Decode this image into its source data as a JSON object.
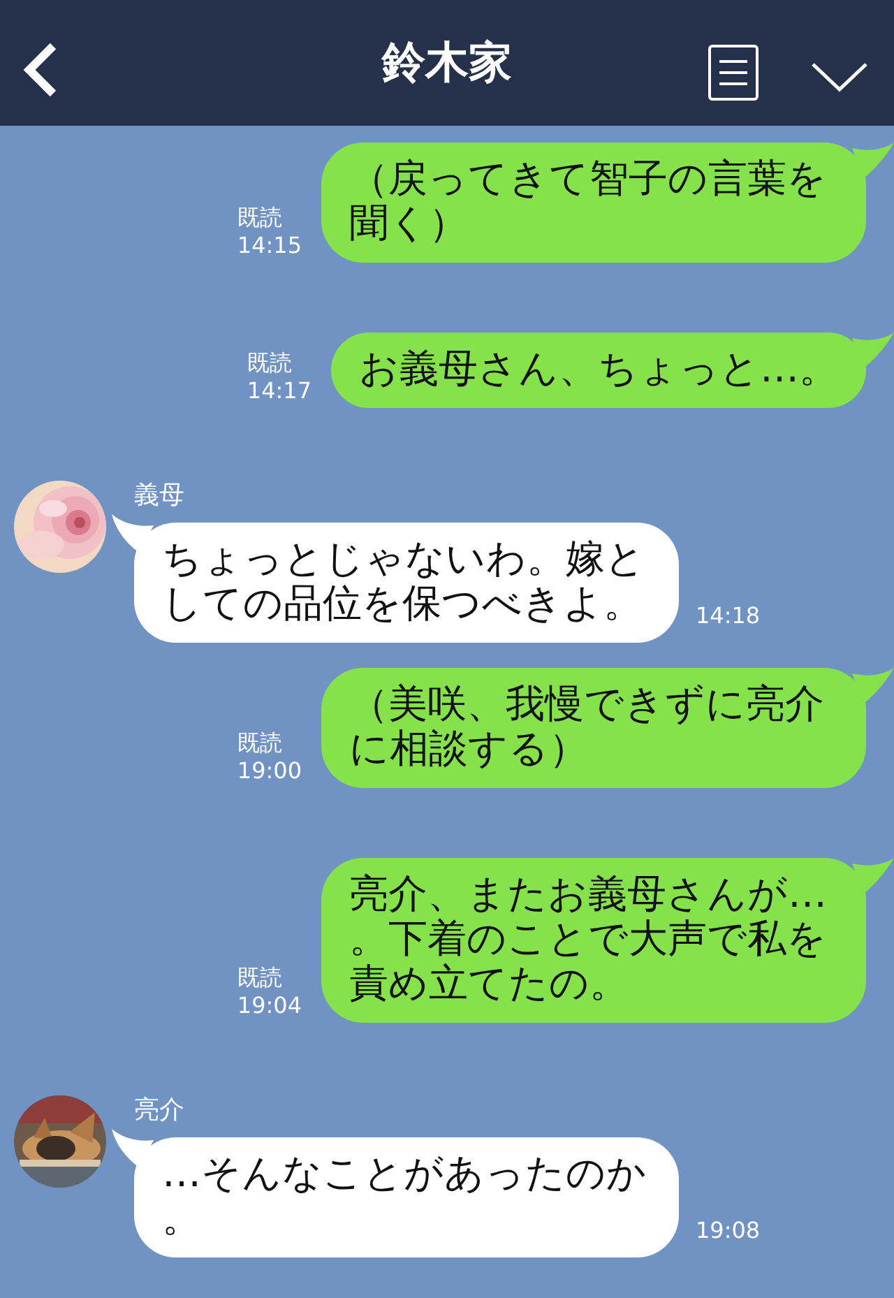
{
  "header": {
    "title": "鈴木家"
  },
  "messages": [
    {
      "kind": "sent",
      "text": "（戻ってきて智子の言葉を聞く）",
      "read": "既読",
      "time": "14:15"
    },
    {
      "kind": "sent",
      "text": "お義母さん、ちょっと…。",
      "read": "既読",
      "time": "14:17"
    },
    {
      "kind": "received",
      "sender": "義母",
      "text": "ちょっとじゃないわ。嫁としての品位を保つべきよ。",
      "time": "14:18"
    },
    {
      "kind": "sent",
      "text": "（美咲、我慢できずに亮介に相談する）",
      "read": "既読",
      "time": "19:00"
    },
    {
      "kind": "sent",
      "text": "亮介、またお義母さんが…。下着のことで大声で私を責め立てたの。",
      "read": "既読",
      "time": "19:04"
    },
    {
      "kind": "received",
      "sender": "亮介",
      "text": "…そんなことがあったのか。",
      "time": "19:08"
    }
  ]
}
